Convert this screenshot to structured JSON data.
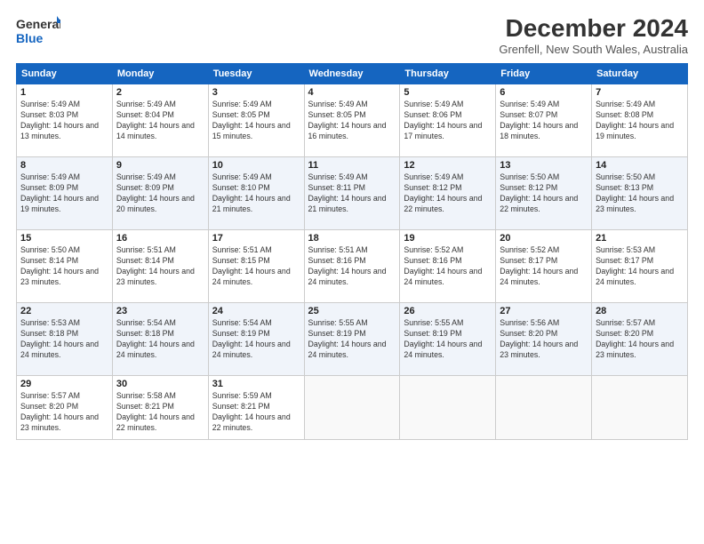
{
  "logo": {
    "line1": "General",
    "line2": "Blue"
  },
  "header": {
    "title": "December 2024",
    "subtitle": "Grenfell, New South Wales, Australia"
  },
  "days_of_week": [
    "Sunday",
    "Monday",
    "Tuesday",
    "Wednesday",
    "Thursday",
    "Friday",
    "Saturday"
  ],
  "weeks": [
    [
      {
        "day": "1",
        "sunrise": "5:49 AM",
        "sunset": "8:03 PM",
        "daylight": "14 hours and 13 minutes."
      },
      {
        "day": "2",
        "sunrise": "5:49 AM",
        "sunset": "8:04 PM",
        "daylight": "14 hours and 14 minutes."
      },
      {
        "day": "3",
        "sunrise": "5:49 AM",
        "sunset": "8:05 PM",
        "daylight": "14 hours and 15 minutes."
      },
      {
        "day": "4",
        "sunrise": "5:49 AM",
        "sunset": "8:05 PM",
        "daylight": "14 hours and 16 minutes."
      },
      {
        "day": "5",
        "sunrise": "5:49 AM",
        "sunset": "8:06 PM",
        "daylight": "14 hours and 17 minutes."
      },
      {
        "day": "6",
        "sunrise": "5:49 AM",
        "sunset": "8:07 PM",
        "daylight": "14 hours and 18 minutes."
      },
      {
        "day": "7",
        "sunrise": "5:49 AM",
        "sunset": "8:08 PM",
        "daylight": "14 hours and 19 minutes."
      }
    ],
    [
      {
        "day": "8",
        "sunrise": "5:49 AM",
        "sunset": "8:09 PM",
        "daylight": "14 hours and 19 minutes."
      },
      {
        "day": "9",
        "sunrise": "5:49 AM",
        "sunset": "8:09 PM",
        "daylight": "14 hours and 20 minutes."
      },
      {
        "day": "10",
        "sunrise": "5:49 AM",
        "sunset": "8:10 PM",
        "daylight": "14 hours and 21 minutes."
      },
      {
        "day": "11",
        "sunrise": "5:49 AM",
        "sunset": "8:11 PM",
        "daylight": "14 hours and 21 minutes."
      },
      {
        "day": "12",
        "sunrise": "5:49 AM",
        "sunset": "8:12 PM",
        "daylight": "14 hours and 22 minutes."
      },
      {
        "day": "13",
        "sunrise": "5:50 AM",
        "sunset": "8:12 PM",
        "daylight": "14 hours and 22 minutes."
      },
      {
        "day": "14",
        "sunrise": "5:50 AM",
        "sunset": "8:13 PM",
        "daylight": "14 hours and 23 minutes."
      }
    ],
    [
      {
        "day": "15",
        "sunrise": "5:50 AM",
        "sunset": "8:14 PM",
        "daylight": "14 hours and 23 minutes."
      },
      {
        "day": "16",
        "sunrise": "5:51 AM",
        "sunset": "8:14 PM",
        "daylight": "14 hours and 23 minutes."
      },
      {
        "day": "17",
        "sunrise": "5:51 AM",
        "sunset": "8:15 PM",
        "daylight": "14 hours and 24 minutes."
      },
      {
        "day": "18",
        "sunrise": "5:51 AM",
        "sunset": "8:16 PM",
        "daylight": "14 hours and 24 minutes."
      },
      {
        "day": "19",
        "sunrise": "5:52 AM",
        "sunset": "8:16 PM",
        "daylight": "14 hours and 24 minutes."
      },
      {
        "day": "20",
        "sunrise": "5:52 AM",
        "sunset": "8:17 PM",
        "daylight": "14 hours and 24 minutes."
      },
      {
        "day": "21",
        "sunrise": "5:53 AM",
        "sunset": "8:17 PM",
        "daylight": "14 hours and 24 minutes."
      }
    ],
    [
      {
        "day": "22",
        "sunrise": "5:53 AM",
        "sunset": "8:18 PM",
        "daylight": "14 hours and 24 minutes."
      },
      {
        "day": "23",
        "sunrise": "5:54 AM",
        "sunset": "8:18 PM",
        "daylight": "14 hours and 24 minutes."
      },
      {
        "day": "24",
        "sunrise": "5:54 AM",
        "sunset": "8:19 PM",
        "daylight": "14 hours and 24 minutes."
      },
      {
        "day": "25",
        "sunrise": "5:55 AM",
        "sunset": "8:19 PM",
        "daylight": "14 hours and 24 minutes."
      },
      {
        "day": "26",
        "sunrise": "5:55 AM",
        "sunset": "8:19 PM",
        "daylight": "14 hours and 24 minutes."
      },
      {
        "day": "27",
        "sunrise": "5:56 AM",
        "sunset": "8:20 PM",
        "daylight": "14 hours and 23 minutes."
      },
      {
        "day": "28",
        "sunrise": "5:57 AM",
        "sunset": "8:20 PM",
        "daylight": "14 hours and 23 minutes."
      }
    ],
    [
      {
        "day": "29",
        "sunrise": "5:57 AM",
        "sunset": "8:20 PM",
        "daylight": "14 hours and 23 minutes."
      },
      {
        "day": "30",
        "sunrise": "5:58 AM",
        "sunset": "8:21 PM",
        "daylight": "14 hours and 22 minutes."
      },
      {
        "day": "31",
        "sunrise": "5:59 AM",
        "sunset": "8:21 PM",
        "daylight": "14 hours and 22 minutes."
      },
      null,
      null,
      null,
      null
    ]
  ]
}
